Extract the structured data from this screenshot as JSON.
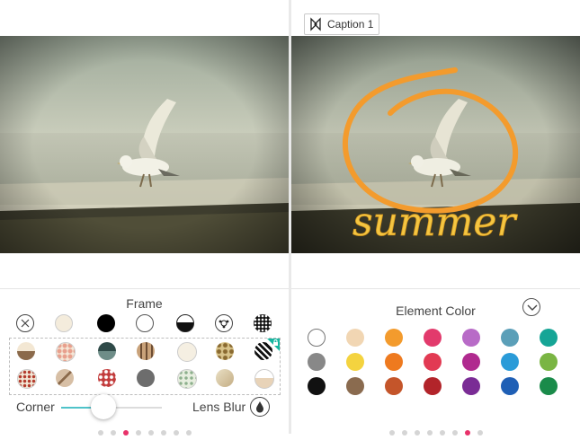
{
  "left": {
    "tool_title": "Frame",
    "slider": {
      "label_left": "Corner",
      "label_right": "Lens Blur",
      "value_fraction": 0.42
    },
    "page_dots": {
      "count": 8,
      "active": 2
    }
  },
  "right": {
    "caption": "Caption 1",
    "overlay_text": "summer",
    "tool_title": "Element Color",
    "page_dots": {
      "count": 8,
      "active": 6
    },
    "colors": [
      [
        "#ffffff",
        "#f1d6b3",
        "#f39b2d",
        "#e23a6c",
        "#b86bc7",
        "#5b9fb8",
        "#16a596"
      ],
      [
        "#888888",
        "#f4d33f",
        "#ee7a1f",
        "#e23a53",
        "#b02a8f",
        "#2a9bd8",
        "#7ab543"
      ],
      [
        "#111111",
        "#8a6b4f",
        "#c4552a",
        "#b2242a",
        "#7a2c95",
        "#1f5fb5",
        "#1a8b4a"
      ]
    ]
  },
  "icons": {
    "none": "no-frame-icon",
    "blur": "droplet-icon",
    "chevron": "chevron-down-icon",
    "caption": "sticker-icon",
    "lock": "lock-icon"
  }
}
